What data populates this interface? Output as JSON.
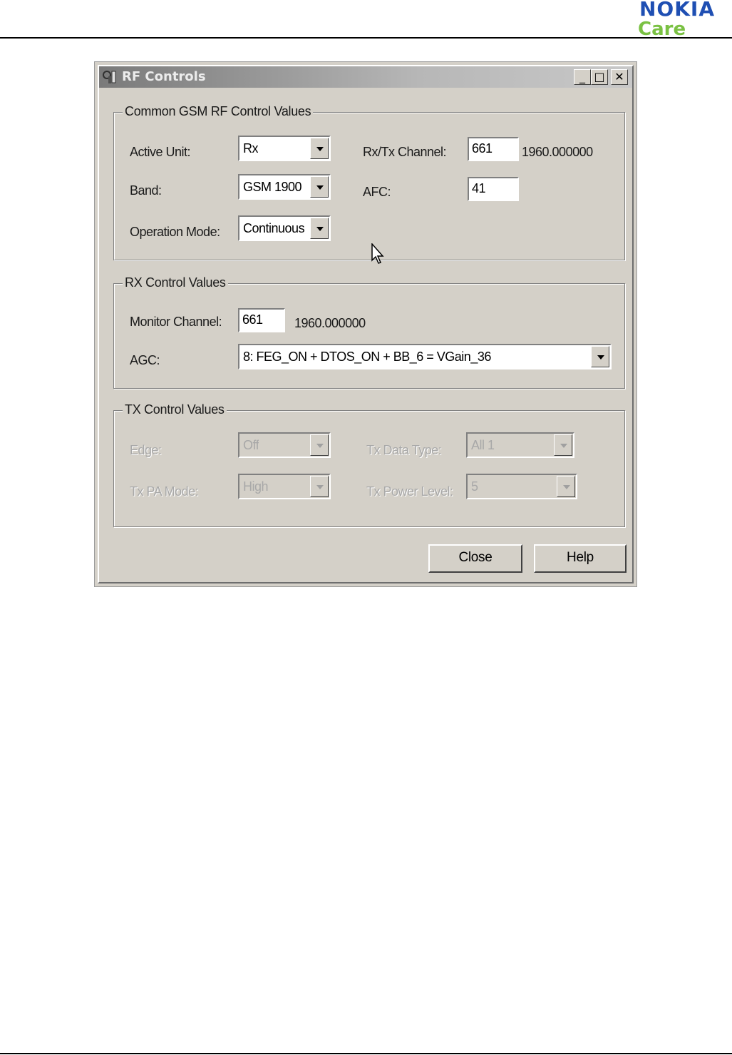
{
  "brand": {
    "name": "NOKIA",
    "sub": "Care"
  },
  "window": {
    "title": "RF Controls",
    "controls": {
      "minimize": "_",
      "maximize": "□",
      "close": "✕"
    }
  },
  "common_group": {
    "title": "Common GSM RF Control Values",
    "active_unit_label": "Active Unit:",
    "active_unit_value": "Rx",
    "band_label": "Band:",
    "band_value": "GSM 1900",
    "operation_mode_label": "Operation Mode:",
    "operation_mode_value": "Continuous",
    "rxtx_channel_label": "Rx/Tx Channel:",
    "rxtx_channel_value": "661",
    "rxtx_frequency": "1960.000000",
    "afc_label": "AFC:",
    "afc_value": "41"
  },
  "rx_group": {
    "title": "RX Control Values",
    "monitor_channel_label": "Monitor Channel:",
    "monitor_channel_value": "661",
    "monitor_frequency": "1960.000000",
    "agc_label": "AGC:",
    "agc_value": "8: FEG_ON + DTOS_ON + BB_6 = VGain_36"
  },
  "tx_group": {
    "title": "TX Control Values",
    "edge_label": "Edge:",
    "edge_value": "Off",
    "tx_pa_mode_label": "Tx PA Mode:",
    "tx_pa_mode_value": "High",
    "tx_data_type_label": "Tx Data Type:",
    "tx_data_type_value": "All 1",
    "tx_power_level_label": "Tx Power Level:",
    "tx_power_level_value": "5"
  },
  "buttons": {
    "close": "Close",
    "help": "Help"
  },
  "colors": {
    "nokia_blue": "#1f4fb3",
    "care_green": "#7ac143",
    "dialog_face": "#d4d0c8"
  }
}
